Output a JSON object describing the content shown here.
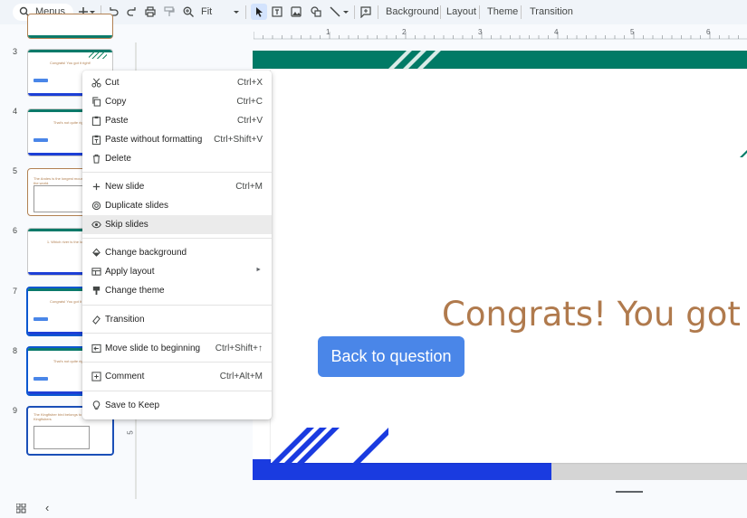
{
  "toolbar": {
    "menus_label": "Menus",
    "zoom_value": "Fit",
    "background_label": "Background",
    "layout_label": "Layout",
    "theme_label": "Theme",
    "transition_label": "Transition",
    "icons": [
      "search-icon",
      "new-icon",
      "dropdown-icon",
      "undo-icon",
      "redo-icon",
      "print-icon",
      "paint-format-icon",
      "zoom-icon",
      "select-icon",
      "textbox-icon",
      "image-icon",
      "shape-icon",
      "line-icon",
      "comment-add-icon"
    ]
  },
  "filmstrip": {
    "slides": [
      {
        "num": "3",
        "caption": "Congrats! You got it right!"
      },
      {
        "num": "4",
        "caption": "That's not quite right!"
      },
      {
        "num": "5",
        "caption": "The Andes is the longest mountain range in the world."
      },
      {
        "num": "6",
        "caption": "1. Which river is the longest?"
      },
      {
        "num": "7",
        "caption": "Congrats! You got it right!"
      },
      {
        "num": "8",
        "caption": "That's not quite right!"
      },
      {
        "num": "9",
        "caption": "The Kingfisher bird belongs to which family? Kingfishers"
      }
    ]
  },
  "ruler": {
    "top_numbers": [
      "1",
      "2",
      "3",
      "4",
      "5",
      "6"
    ],
    "left_number": "5"
  },
  "slide": {
    "heading": "Congrats! You got it",
    "button_label": "Back to question",
    "colors": {
      "heading": "#b07a4d",
      "button": "#4a86e8",
      "top_band": "#007a66",
      "bottom_band": "#1a3be0"
    }
  },
  "context_menu": {
    "items": [
      {
        "label": "Cut",
        "shortcut": "Ctrl+X",
        "icon": "scissors-icon"
      },
      {
        "label": "Copy",
        "shortcut": "Ctrl+C",
        "icon": "copy-icon"
      },
      {
        "label": "Paste",
        "shortcut": "Ctrl+V",
        "icon": "paste-icon"
      },
      {
        "label": "Paste without formatting",
        "shortcut": "Ctrl+Shift+V",
        "icon": "paste-plain-icon"
      },
      {
        "label": "Delete",
        "shortcut": "",
        "icon": "trash-icon"
      },
      {
        "label": "New slide",
        "shortcut": "Ctrl+M",
        "icon": "plus-icon"
      },
      {
        "label": "Duplicate slides",
        "shortcut": "",
        "icon": "duplicate-icon"
      },
      {
        "label": "Skip slides",
        "shortcut": "",
        "icon": "eye-icon"
      },
      {
        "label": "Change background",
        "shortcut": "",
        "icon": "fill-icon"
      },
      {
        "label": "Apply layout",
        "shortcut": "",
        "icon": "layout-icon"
      },
      {
        "label": "Change theme",
        "shortcut": "",
        "icon": "theme-icon"
      },
      {
        "label": "Transition",
        "shortcut": "",
        "icon": "transition-icon"
      },
      {
        "label": "Move slide to beginning",
        "shortcut": "Ctrl+Shift+↑",
        "icon": "move-to-start-icon"
      },
      {
        "label": "Comment",
        "shortcut": "Ctrl+Alt+M",
        "icon": "comment-icon"
      },
      {
        "label": "Save to Keep",
        "shortcut": "",
        "icon": "keep-icon"
      }
    ],
    "hovered_item": "Skip slides"
  }
}
